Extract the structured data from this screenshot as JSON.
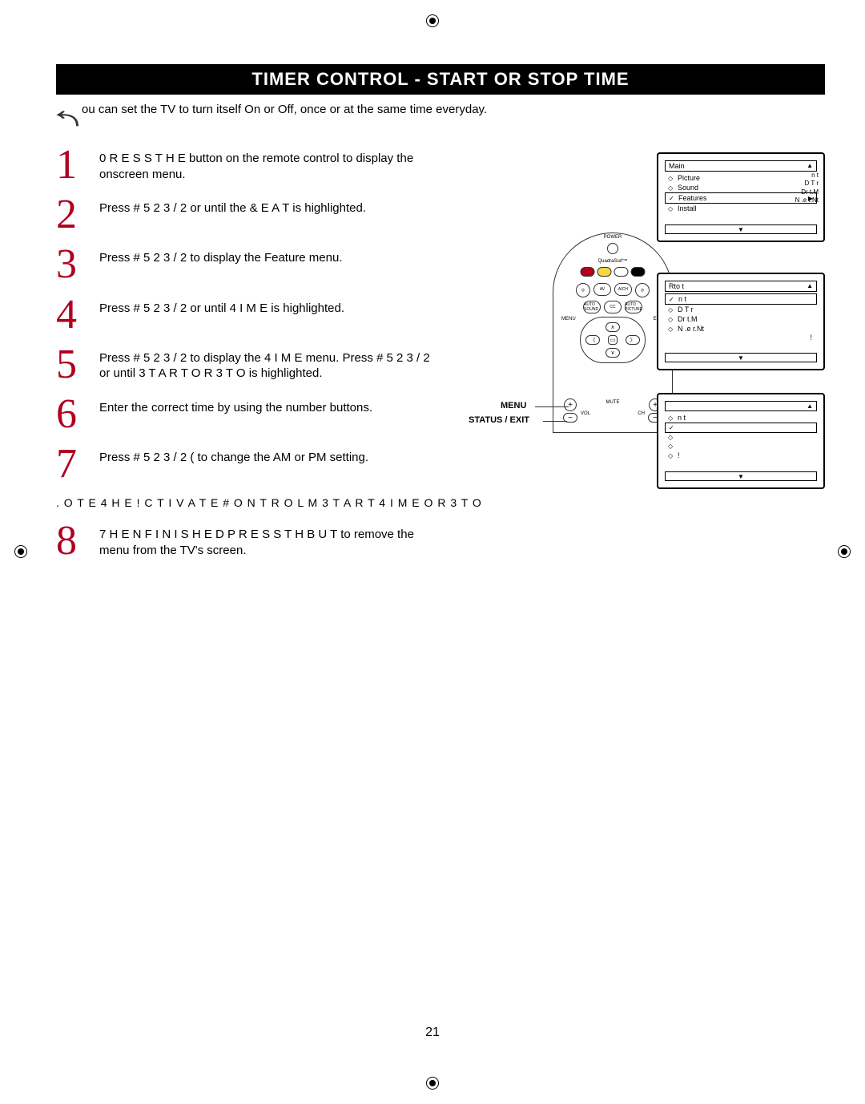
{
  "registration_marks": true,
  "title": "TIMER CONTROL  -  START OR STOP TIME",
  "intro": "ou can set the TV to turn itself On or Off, once or at the same time everyday.",
  "steps": [
    {
      "num": "1",
      "text": "0 R E S S   T H E button on the remote control to display the onscreen menu."
    },
    {
      "num": "2",
      "text": "Press  # 5 2 3 / 2      or     until the  & E A T is highlighted."
    },
    {
      "num": "3",
      "text": "Press  # 5 2 3 / 2    to display the Feature menu."
    },
    {
      "num": "4",
      "text": "Press  # 5 2 3 / 2     or     until  4 I M E is highlighted."
    },
    {
      "num": "5",
      "text": "Press  # 5 2 3 / 2    to display the  4 I M E menu. Press  # 5 2 3 / 2       or      until  3 T A R T    O R   3 T O  is highlighted."
    },
    {
      "num": "6",
      "text": "Enter the correct time by using the number buttons."
    },
    {
      "num": "7",
      "text": "Press  # 5 2 3 / 2        ( to change the AM or PM setting."
    }
  ],
  "note": ". O T E     4 H E  ! C T I V A T E  # O N T R O L  M 3 T A R T  4 I M E  O R  3 T O",
  "step8": {
    "num": "8",
    "text": "7 H E N   F I N I S H E D    P R E S S   T H B U T  to remove the menu from the TV's screen."
  },
  "remote_callouts": {
    "menu": "MENU",
    "status_exit": "STATUS / EXIT"
  },
  "remote": {
    "power_label": "POWER",
    "surf_label": "QuadraSurf™",
    "buttons_row1": [
      "",
      "AV",
      "A/CH",
      ""
    ],
    "buttons_row2": [
      "AUTO SOUND",
      "CC",
      "AUTO PICTURE"
    ],
    "status_label": "STATUS",
    "menu_corner": "MENU",
    "exit_corner": "EXIT",
    "mute": "MUTE",
    "vol": "VOL",
    "ch": "CH"
  },
  "menu1": {
    "title": "Main",
    "arrow_up": "▲",
    "items": [
      {
        "marker": "◇",
        "label": "Picture",
        "sel": false
      },
      {
        "marker": "◇",
        "label": "Sound",
        "sel": false
      },
      {
        "marker": "✓",
        "label": "Features",
        "sel": true
      },
      {
        "marker": "◇",
        "label": "Install",
        "sel": false
      }
    ],
    "side_lines": [
      "n      t",
      "D        T    r",
      "Dr       t.M",
      "N       .e   r.Nt"
    ],
    "footer_arrow": "▼"
  },
  "menu2": {
    "title": "Rto          t",
    "arrow_up": "▲",
    "items": [
      {
        "marker": "✓",
        "label": "n       t",
        "sel": true
      },
      {
        "marker": "◇",
        "label": "D          T    r",
        "sel": false
      },
      {
        "marker": "◇",
        "label": "Dr       t.M",
        "sel": false
      },
      {
        "marker": "◇",
        "label": "N       .e   r.Nt",
        "sel": false
      }
    ],
    "footer_arrow": "▼",
    "footer_right": "!"
  },
  "menu3": {
    "title": "",
    "arrow_up": "▲",
    "items": [
      {
        "marker": "◇",
        "label": "n   t",
        "sel": false
      },
      {
        "marker": "✓",
        "label": "",
        "sel": true
      },
      {
        "marker": "◇",
        "label": "",
        "sel": false
      },
      {
        "marker": "◇",
        "label": "",
        "sel": false
      },
      {
        "marker": "◇",
        "label": "         !",
        "sel": false
      }
    ],
    "footer_arrow": "▼"
  },
  "page_number": "21"
}
